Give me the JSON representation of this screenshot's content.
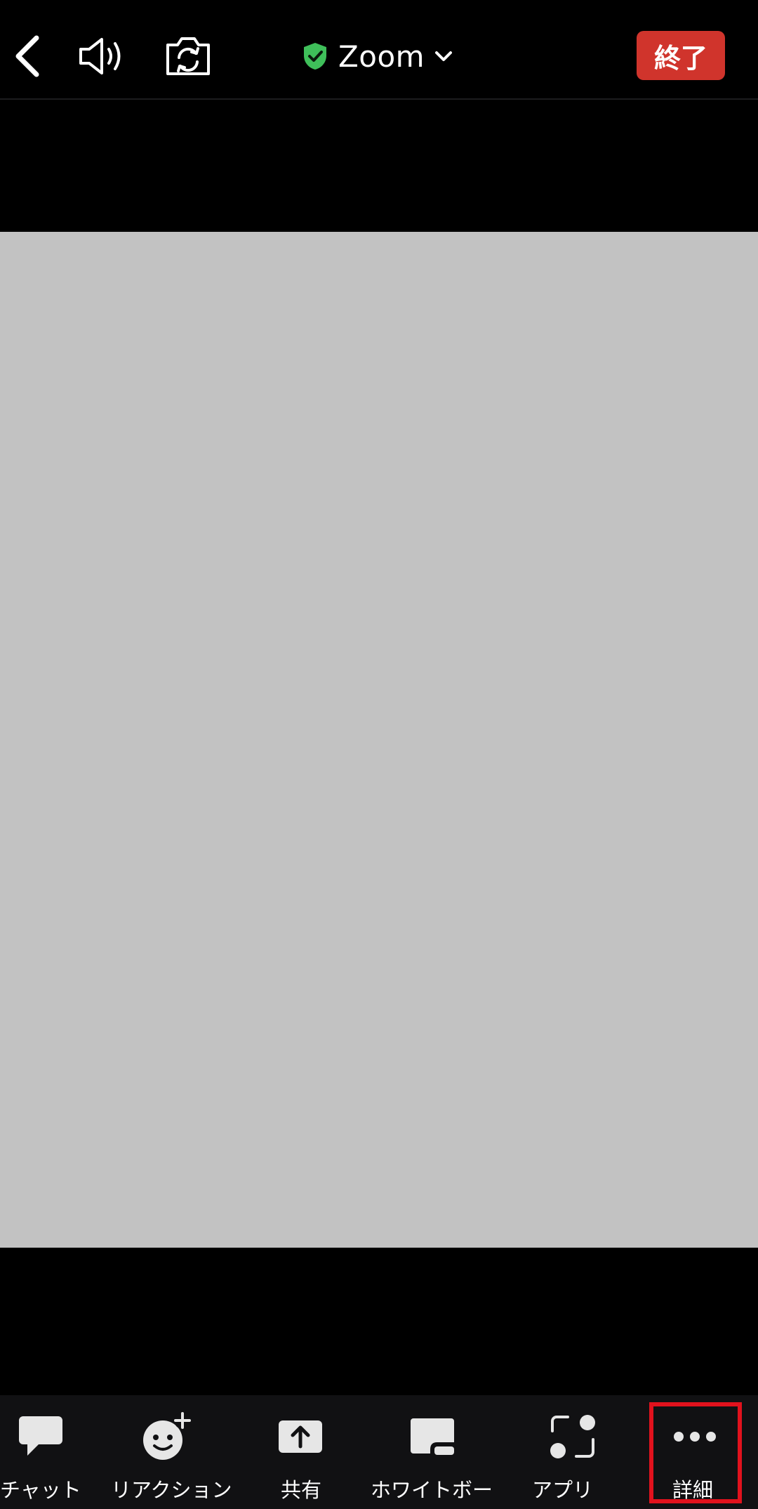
{
  "topbar": {
    "back_icon": "chevron-left-icon",
    "speaker_icon": "speaker-icon",
    "camera_icon": "camera-switch-icon",
    "title": "Zoom",
    "shield_icon": "shield-check-icon",
    "dropdown_icon": "chevron-down-icon",
    "end_label": "終了"
  },
  "bottombar": {
    "items": [
      {
        "label": "チャット",
        "icon": "chat-bubble-icon"
      },
      {
        "label": "リアクション",
        "icon": "reaction-smiley-icon"
      },
      {
        "label": "共有",
        "icon": "share-upload-icon"
      },
      {
        "label": "ホワイトボー",
        "icon": "whiteboard-icon"
      },
      {
        "label": "アプリ",
        "icon": "apps-icon"
      },
      {
        "label": "詳細",
        "icon": "more-dots-icon"
      }
    ]
  },
  "colors": {
    "end_button": "#d0342c",
    "shield": "#3fbf5a",
    "video_background": "#c2c2c2",
    "highlight": "#e1121d"
  }
}
